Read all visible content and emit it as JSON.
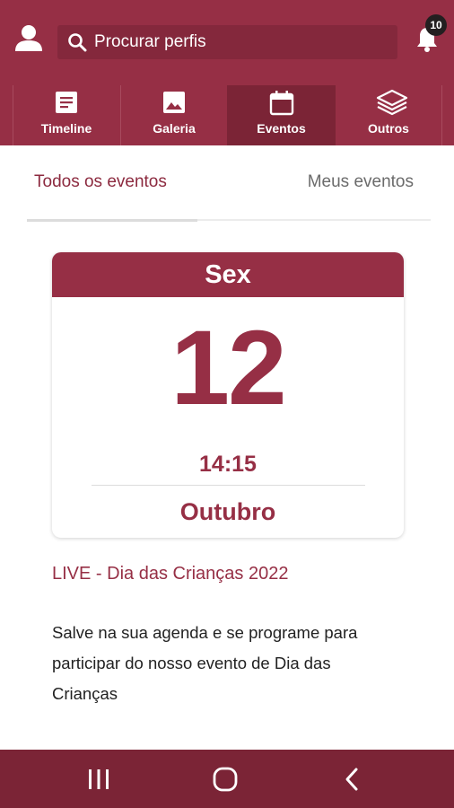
{
  "header": {
    "search": {
      "placeholder": "Procurar perfis",
      "icon": "search-icon"
    },
    "notifications": {
      "icon": "bell-icon",
      "count": "10"
    },
    "user_icon": "user-icon"
  },
  "tabs": [
    {
      "label": "Timeline",
      "icon": "document-icon",
      "active": false
    },
    {
      "label": "Galeria",
      "icon": "image-icon",
      "active": false
    },
    {
      "label": "Eventos",
      "icon": "calendar-icon",
      "active": true
    },
    {
      "label": "Outros",
      "icon": "layers-icon",
      "active": false
    }
  ],
  "subtabs": {
    "all": "Todos os eventos",
    "mine": "Meus eventos",
    "active": "all"
  },
  "event": {
    "weekday": "Sex",
    "day": "12",
    "time": "14:15",
    "month": "Outubro",
    "title": "LIVE - Dia das Crianças 2022",
    "description": "Salve na sua agenda e se programe para participar do nosso evento de Dia das Crianças"
  },
  "navbar": {
    "recents_icon": "recents-icon",
    "home_icon": "home-icon",
    "back_icon": "back-icon"
  },
  "colors": {
    "brand": "#962f45",
    "brand_dark": "#7b2436",
    "search_bg": "#84283c"
  }
}
